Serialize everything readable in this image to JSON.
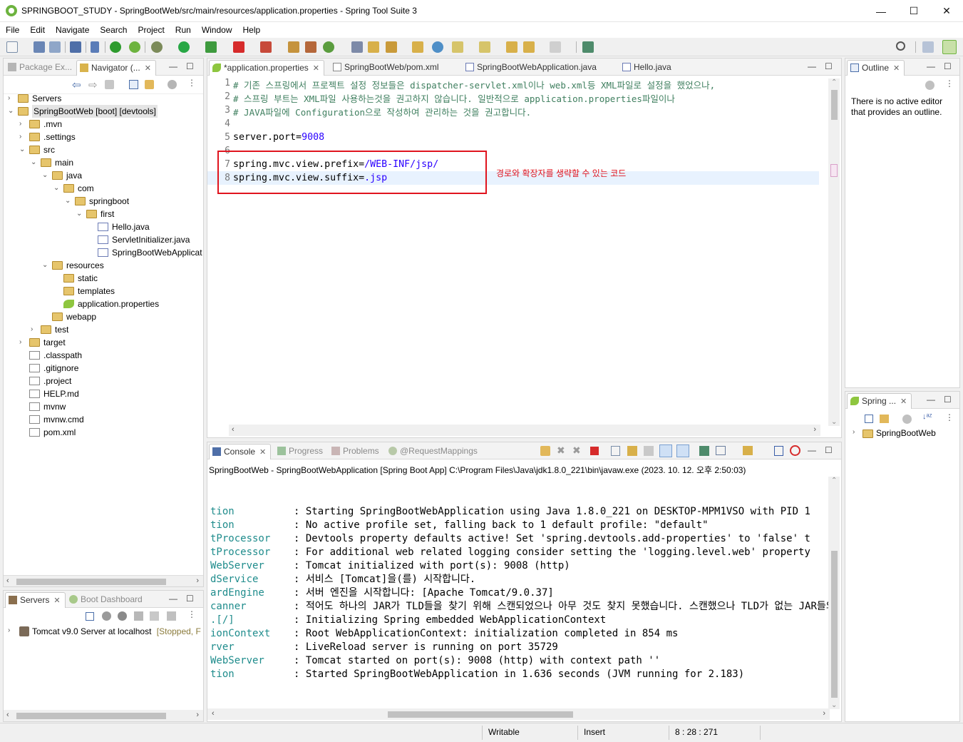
{
  "window": {
    "title": "SPRINGBOOT_STUDY - SpringBootWeb/src/main/resources/application.properties - Spring Tool Suite 3",
    "minimize": "—",
    "maximize": "☐",
    "close": "✕"
  },
  "menu": [
    "File",
    "Edit",
    "Navigate",
    "Search",
    "Project",
    "Run",
    "Window",
    "Help"
  ],
  "left_panel": {
    "tabs": [
      {
        "label": "Package Ex..."
      },
      {
        "label": "Navigator (..."
      }
    ],
    "tree": [
      {
        "label": "Servers",
        "indent": 0,
        "arrow": "›",
        "icon": "folder"
      },
      {
        "label": "SpringBootWeb [boot] [devtools]",
        "indent": 0,
        "arrow": "⌄",
        "icon": "project",
        "selected": true
      },
      {
        "label": ".mvn",
        "indent": 1,
        "arrow": "›",
        "icon": "folder"
      },
      {
        "label": ".settings",
        "indent": 1,
        "arrow": "›",
        "icon": "folder"
      },
      {
        "label": "src",
        "indent": 1,
        "arrow": "⌄",
        "icon": "folder"
      },
      {
        "label": "main",
        "indent": 2,
        "arrow": "⌄",
        "icon": "folder"
      },
      {
        "label": "java",
        "indent": 3,
        "arrow": "⌄",
        "icon": "folder"
      },
      {
        "label": "com",
        "indent": 4,
        "arrow": "⌄",
        "icon": "folder"
      },
      {
        "label": "springboot",
        "indent": 5,
        "arrow": "⌄",
        "icon": "folder"
      },
      {
        "label": "first",
        "indent": 6,
        "arrow": "⌄",
        "icon": "folder"
      },
      {
        "label": "Hello.java",
        "indent": 7,
        "arrow": "",
        "icon": "java"
      },
      {
        "label": "ServletInitializer.java",
        "indent": 7,
        "arrow": "",
        "icon": "java"
      },
      {
        "label": "SpringBootWebApplicat",
        "indent": 7,
        "arrow": "",
        "icon": "java"
      },
      {
        "label": "resources",
        "indent": 3,
        "arrow": "⌄",
        "icon": "folder"
      },
      {
        "label": "static",
        "indent": 4,
        "arrow": "",
        "icon": "folder"
      },
      {
        "label": "templates",
        "indent": 4,
        "arrow": "",
        "icon": "folder"
      },
      {
        "label": "application.properties",
        "indent": 4,
        "arrow": "",
        "icon": "leaf"
      },
      {
        "label": "webapp",
        "indent": 3,
        "arrow": "",
        "icon": "folder"
      },
      {
        "label": "test",
        "indent": 2,
        "arrow": "›",
        "icon": "folder"
      },
      {
        "label": "target",
        "indent": 1,
        "arrow": "›",
        "icon": "folder"
      },
      {
        "label": ".classpath",
        "indent": 1,
        "arrow": "",
        "icon": "xml"
      },
      {
        "label": ".gitignore",
        "indent": 1,
        "arrow": "",
        "icon": "file"
      },
      {
        "label": ".project",
        "indent": 1,
        "arrow": "",
        "icon": "xml"
      },
      {
        "label": "HELP.md",
        "indent": 1,
        "arrow": "",
        "icon": "file"
      },
      {
        "label": "mvnw",
        "indent": 1,
        "arrow": "",
        "icon": "file"
      },
      {
        "label": "mvnw.cmd",
        "indent": 1,
        "arrow": "",
        "icon": "file"
      },
      {
        "label": "pom.xml",
        "indent": 1,
        "arrow": "",
        "icon": "file"
      }
    ]
  },
  "servers_panel": {
    "tabs": [
      {
        "label": "Servers"
      },
      {
        "label": "Boot Dashboard"
      }
    ],
    "server_name": "Tomcat v9.0 Server at localhost",
    "server_state": "[Stopped, F"
  },
  "editor": {
    "tabs": [
      {
        "label": "*application.properties"
      },
      {
        "label": "SpringBootWeb/pom.xml"
      },
      {
        "label": "SpringBootWebApplication.java"
      },
      {
        "label": "Hello.java"
      }
    ],
    "lines": [
      {
        "n": "1",
        "text": "# 기존 스프링에서 프로젝트 설정 정보들은 dispatcher-servlet.xml이나 web.xml등 XML파일로 설정을 했었으나,",
        "kind": "comment"
      },
      {
        "n": "2",
        "text": "# 스프링 부트는 XML파일 사용하는것을 권고하지 않습니다. 일반적으로 application.properties파일이나",
        "kind": "comment"
      },
      {
        "n": "3",
        "text": "# JAVA파일에 Configuration으로 작성하여 관리하는 것을 권고합니다.",
        "kind": "comment"
      },
      {
        "n": "4",
        "text": "",
        "kind": "plain"
      },
      {
        "n": "5",
        "key": "server.port=",
        "val": "9008",
        "kind": "kv"
      },
      {
        "n": "6",
        "text": "",
        "kind": "plain"
      },
      {
        "n": "7",
        "key": "spring.mvc.view.prefix=",
        "val": "/WEB-INF/jsp/",
        "kind": "kv"
      },
      {
        "n": "8",
        "key": "spring.mvc.view.suffix=",
        "val": ".jsp",
        "kind": "kv"
      }
    ],
    "annotation": "경로와 확장자를 생략할 수 있는 코드",
    "highlight_color": "#e8f2fe",
    "annotation_color": "#e0141e"
  },
  "outline": {
    "tab": "Outline",
    "message": "There is no active editor that provides an outline."
  },
  "spring_panel": {
    "tab": "Spring ...",
    "item": "SpringBootWeb"
  },
  "console": {
    "tabs": [
      {
        "label": "Console"
      },
      {
        "label": "Progress"
      },
      {
        "label": "Problems"
      },
      {
        "label": "@RequestMappings"
      }
    ],
    "header": "SpringBootWeb - SpringBootWebApplication [Spring Boot App] C:\\Program Files\\Java\\jdk1.8.0_221\\bin\\javaw.exe  (2023. 10. 12. 오후 2:50:03)",
    "lines": [
      {
        "src": "tion",
        "msg": ": Starting SpringBootWebApplication using Java 1.8.0_221 on DESKTOP-MPM1VSO with PID 1"
      },
      {
        "src": "tion",
        "msg": ": No active profile set, falling back to 1 default profile: \"default\""
      },
      {
        "src": "tProcessor",
        "msg": ": Devtools property defaults active! Set 'spring.devtools.add-properties' to 'false' t"
      },
      {
        "src": "tProcessor",
        "msg": ": For additional web related logging consider setting the 'logging.level.web' property"
      },
      {
        "src": "WebServer",
        "msg": ": Tomcat initialized with port(s): 9008 (http)"
      },
      {
        "src": "dService",
        "msg": ": 서비스 [Tomcat]을(를) 시작합니다."
      },
      {
        "src": "ardEngine",
        "msg": ": 서버 엔진을 시작합니다: [Apache Tomcat/9.0.37]"
      },
      {
        "src": "canner",
        "msg": ": 적어도 하나의 JAR가 TLD들을 찾기 위해 스캔되었으나 아무 것도 찾지 못했습니다. 스캔했으나 TLD가 없는 JAR들의 전체 목록을 보시"
      },
      {
        "src": ".[/]",
        "msg": ": Initializing Spring embedded WebApplicationContext"
      },
      {
        "src": "ionContext",
        "msg": ": Root WebApplicationContext: initialization completed in 854 ms"
      },
      {
        "src": "rver",
        "msg": ": LiveReload server is running on port 35729"
      },
      {
        "src": "WebServer",
        "msg": ": Tomcat started on port(s): 9008 (http) with context path ''"
      },
      {
        "src": "tion",
        "msg": ": Started SpringBootWebApplication in 1.636 seconds (JVM running for 2.183)"
      }
    ]
  },
  "status": {
    "mode": "Writable",
    "insert": "Insert",
    "position": "8 : 28 : 271"
  }
}
